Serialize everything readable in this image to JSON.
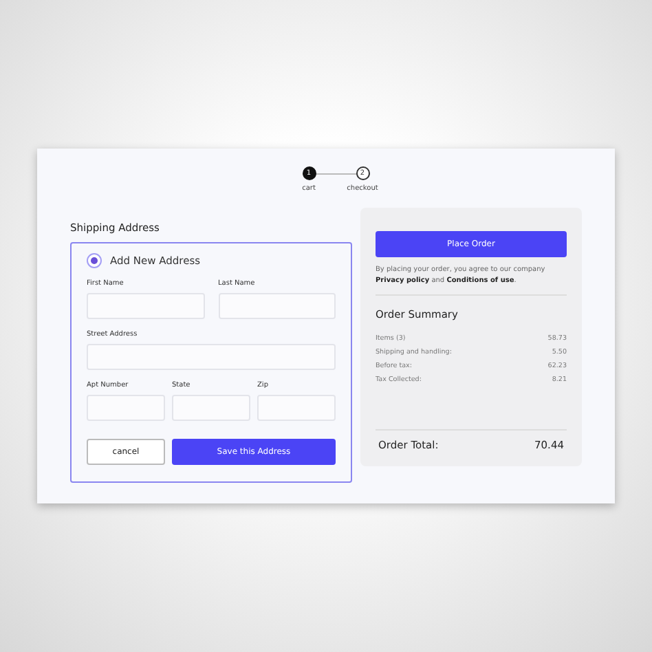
{
  "steps": [
    {
      "number": "1",
      "label": "cart",
      "active": true
    },
    {
      "number": "2",
      "label": "checkout",
      "active": false
    }
  ],
  "shipping": {
    "title": "Shipping Address",
    "option": {
      "label": "Add New Address",
      "selected": true
    },
    "rows": [
      [
        {
          "label": "First Name"
        },
        {
          "label": "Last Name"
        }
      ],
      [
        {
          "label": "Street Address"
        }
      ],
      [
        {
          "label": "Apt Number"
        },
        {
          "label": "State"
        },
        {
          "label": "Zip"
        }
      ]
    ],
    "cancel": "cancel",
    "save": "Save this Address"
  },
  "order": {
    "button": "Place Order",
    "notice": "By placing your order, you agree to our company **Privacy policy** and **Conditions of use**.",
    "summary_title": "Order Summary",
    "lines": [
      {
        "label": "Items (3)",
        "value": "58.73"
      },
      {
        "label": "Shipping and handling:",
        "value": "5.50"
      },
      {
        "label": "Before tax:",
        "value": "62.23"
      },
      {
        "label": "Tax Collected:",
        "value": "8.21"
      }
    ],
    "total": {
      "label": "Order Total:",
      "value": "70.44"
    }
  }
}
